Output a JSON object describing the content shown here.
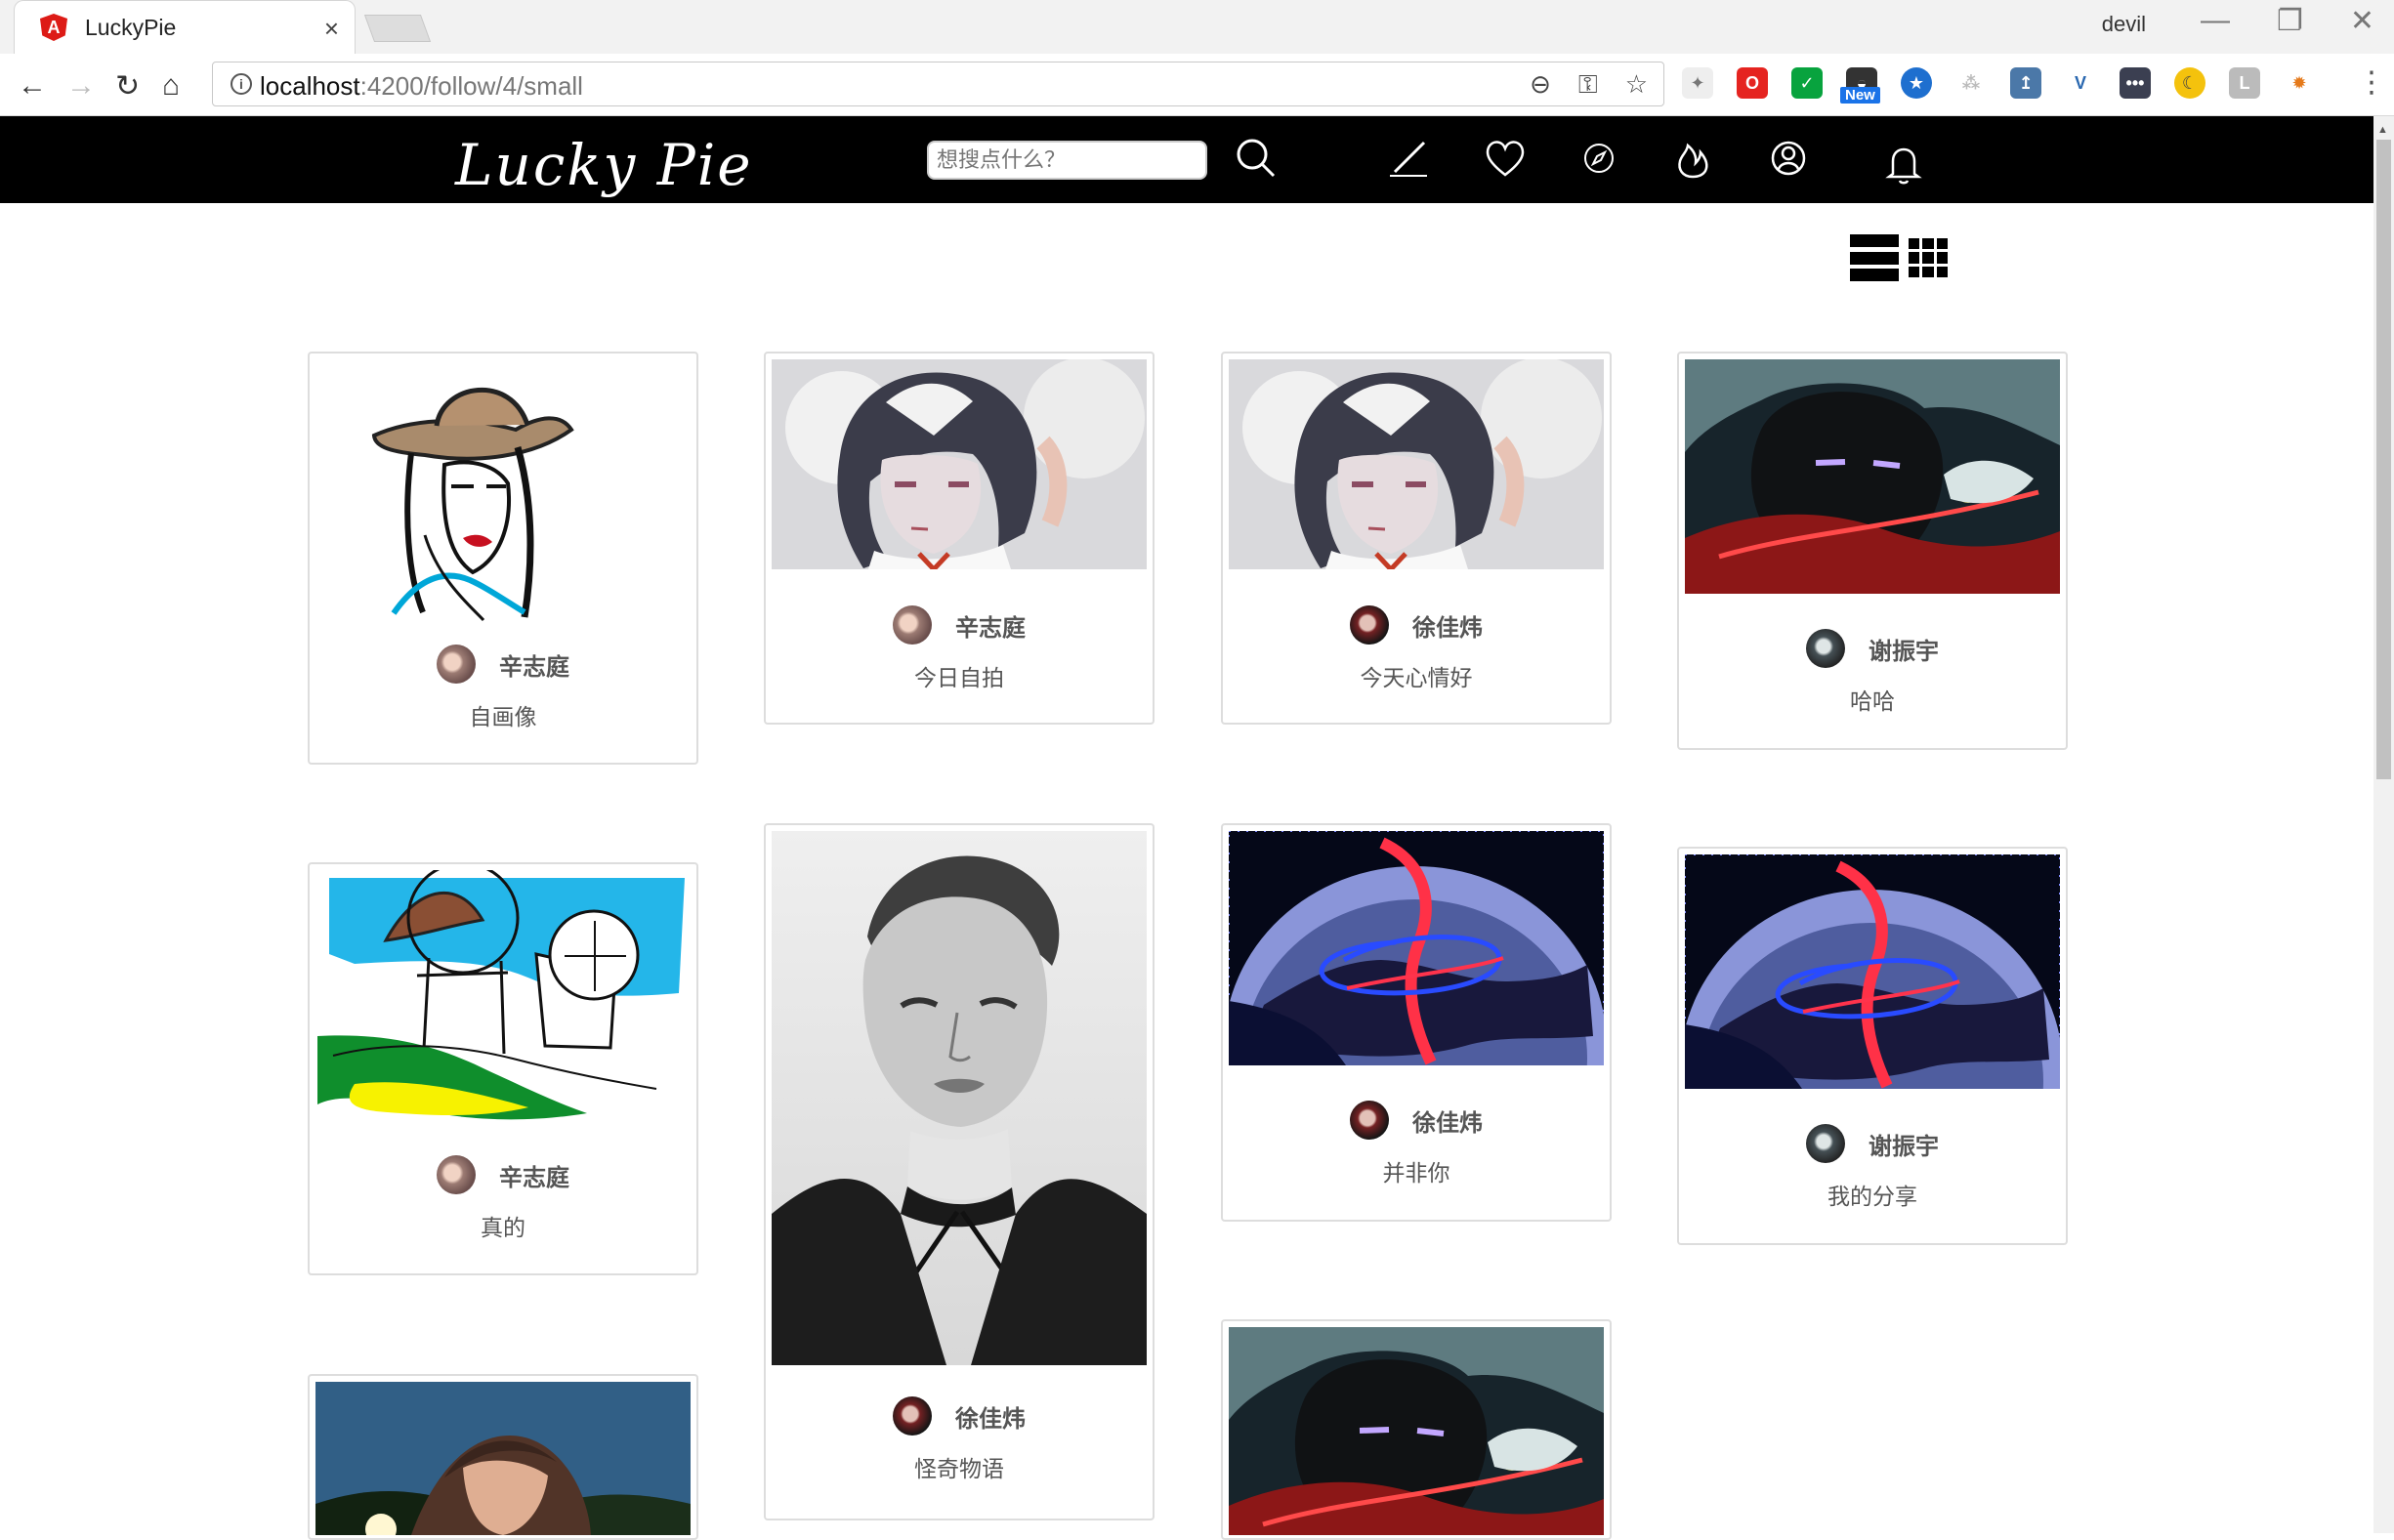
{
  "browser": {
    "tab_title": "LuckyPie",
    "tab_close": "×",
    "profile_name": "devil",
    "window_controls": [
      "—",
      "❐",
      "✕"
    ],
    "url_host": "localhost",
    "url_path": ":4200/follow/4/small",
    "new_badge": "New"
  },
  "app": {
    "logo": "Lucky Pie",
    "search_placeholder": "想搜点什么？",
    "icons": [
      "search-icon",
      "pen-icon",
      "heart-icon",
      "compass-icon",
      "flame-icon",
      "user-icon",
      "bell-icon"
    ]
  },
  "cards": [
    {
      "author": "辛志庭",
      "caption": "自画像"
    },
    {
      "author": "辛志庭",
      "caption": "今日自拍"
    },
    {
      "author": "徐佳炜",
      "caption": "今天心情好"
    },
    {
      "author": "谢振宇",
      "caption": "哈哈"
    },
    {
      "author": "辛志庭",
      "caption": "真的"
    },
    {
      "author": "徐佳炜",
      "caption": "怪奇物语"
    },
    {
      "author": "徐佳炜",
      "caption": "并非你"
    },
    {
      "author": "谢振宇",
      "caption": "我的分享"
    },
    {
      "author": "",
      "caption": ""
    },
    {
      "author": "",
      "caption": ""
    }
  ],
  "colors": {
    "header_bg": "#000000",
    "text": "#555555",
    "angular_red": "#dd1b16"
  }
}
